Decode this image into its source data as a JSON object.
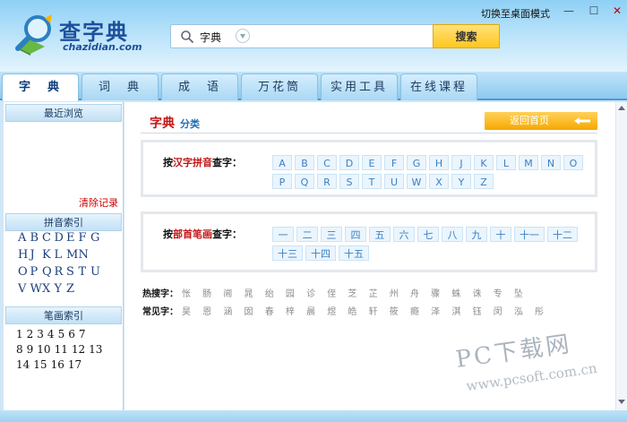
{
  "header": {
    "logo_title": "查字典",
    "logo_subtitle": "chazidian.com",
    "switch_mode": "切换至桌面模式",
    "min": "—",
    "max": "☐",
    "close": "✕"
  },
  "search": {
    "type": "字典",
    "value": "",
    "button": "搜索"
  },
  "tabs": [
    "字　典",
    "词　典",
    "成　语",
    "万花筒",
    "实用工具",
    "在线课程"
  ],
  "sidebar": {
    "recent": "最近浏览",
    "clear": "清除记录",
    "pinyin_index": "拼音索引",
    "pinyin_rows": [
      [
        "A",
        "B",
        "C",
        "D",
        "E",
        "F",
        "G"
      ],
      [
        "H",
        "J",
        "K",
        "L",
        "M",
        "N"
      ],
      [
        "O",
        "P",
        "Q",
        "R",
        "S",
        "T",
        "U"
      ],
      [
        "V",
        "W",
        "X",
        "Y",
        "Z"
      ]
    ],
    "stroke_index": "笔画索引",
    "stroke_rows": [
      [
        "1",
        "2",
        "3",
        "4",
        "5",
        "6",
        "7"
      ],
      [
        "8",
        "9",
        "10",
        "11",
        "12",
        "13"
      ],
      [
        "14",
        "15",
        "16",
        "17"
      ]
    ]
  },
  "main": {
    "title": "字典",
    "subtitle": "分类",
    "back_home": "返回首页",
    "pinyin_panel": {
      "prefix": "按",
      "highlight": "汉字拼音",
      "suffix": "查字："
    },
    "letters": [
      "A",
      "B",
      "C",
      "D",
      "E",
      "F",
      "G",
      "H",
      "J",
      "K",
      "L",
      "M",
      "N",
      "O",
      "P",
      "Q",
      "R",
      "S",
      "T",
      "U",
      "W",
      "X",
      "Y",
      "Z"
    ],
    "radical_panel": {
      "prefix": "按",
      "highlight": "部首笔画",
      "suffix": "查字："
    },
    "radicals": [
      "一",
      "二",
      "三",
      "四",
      "五",
      "六",
      "七",
      "八",
      "九",
      "十",
      "十一",
      "十二",
      "十三",
      "十四",
      "十五"
    ],
    "hot_label": "热搜字：",
    "hot_chars": "怅 肠 阃 晁 绐 园 诊 侄 芝 芷 州 舟 骤 蛛 诛 专 坠",
    "common_label": "常见字：",
    "common_chars": "昊 恩 涵 囡 春 梓 晨 煜 皓 轩 筱 瘾 泽 淇 钰 闵 泓 彤"
  },
  "watermark": {
    "line1": "PC下载网",
    "line2": "www.pcsoft.com.cn"
  },
  "colors": {
    "accent": "#c31515",
    "link": "#3d7fc1",
    "button": "#ffc61e"
  }
}
